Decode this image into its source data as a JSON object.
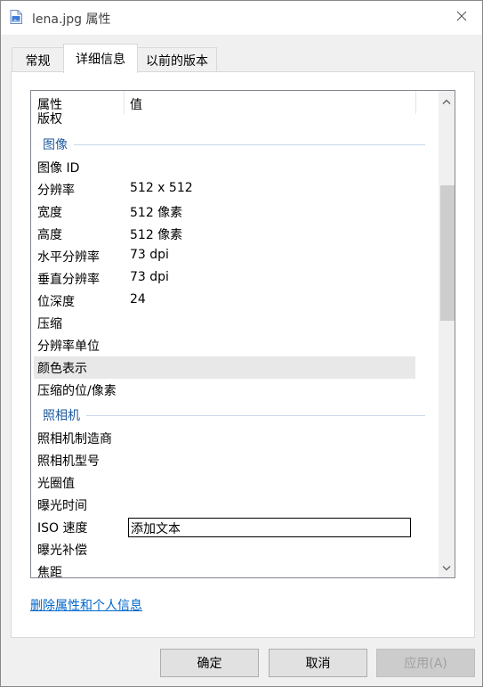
{
  "window": {
    "title": "lena.jpg 属性"
  },
  "tabs": [
    {
      "label": "常规"
    },
    {
      "label": "详细信息"
    },
    {
      "label": "以前的版本"
    }
  ],
  "columns": {
    "name": "属性",
    "value": "值"
  },
  "rows": {
    "copyright": {
      "name": "版权",
      "value": ""
    },
    "group_image": "图像",
    "image_id": {
      "name": "图像 ID",
      "value": ""
    },
    "resolution": {
      "name": "分辨率",
      "value": "512 x 512"
    },
    "width": {
      "name": "宽度",
      "value": "512 像素"
    },
    "height": {
      "name": "高度",
      "value": "512 像素"
    },
    "hres": {
      "name": "水平分辨率",
      "value": "73 dpi"
    },
    "vres": {
      "name": "垂直分辨率",
      "value": "73 dpi"
    },
    "depth": {
      "name": "位深度",
      "value": "24"
    },
    "compression": {
      "name": "压缩",
      "value": ""
    },
    "res_unit": {
      "name": "分辨率单位",
      "value": ""
    },
    "color_rep": {
      "name": "颜色表示",
      "value": ""
    },
    "comp_bits": {
      "name": "压缩的位/像素",
      "value": ""
    },
    "group_camera": "照相机",
    "maker": {
      "name": "照相机制造商",
      "value": ""
    },
    "model": {
      "name": "照相机型号",
      "value": ""
    },
    "fstop": {
      "name": "光圈值",
      "value": ""
    },
    "exposure": {
      "name": "曝光时间",
      "value": ""
    },
    "iso": {
      "name": "ISO 速度",
      "value": "添加文本"
    },
    "exp_bias": {
      "name": "曝光补偿",
      "value": ""
    },
    "focal": {
      "name": "焦距",
      "value": ""
    }
  },
  "link": {
    "remove_label": "删除属性和个人信息"
  },
  "buttons": {
    "ok": "确定",
    "cancel": "取消",
    "apply": "应用(A)"
  },
  "colors": {
    "accent": "#0066cc",
    "group": "#1e5a9e",
    "selected_row": "#e8e8e8"
  },
  "icons": {
    "title": "image-file-icon",
    "close": "close-icon",
    "scroll_up": "chevron-up-icon",
    "scroll_down": "chevron-down-icon"
  }
}
